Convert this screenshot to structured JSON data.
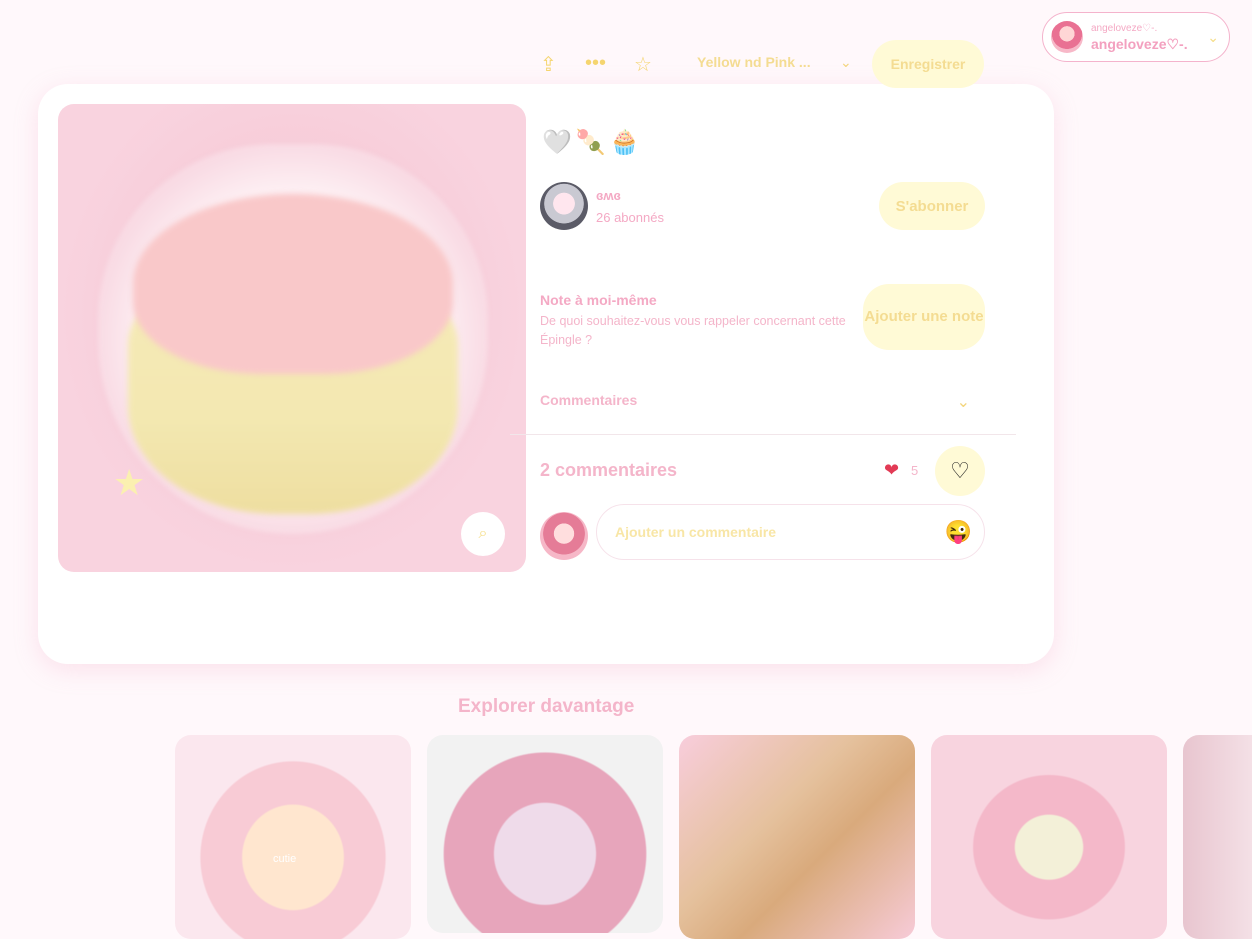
{
  "account": {
    "username_small": "angeloveze♡-.",
    "username": "angeloveze♡-."
  },
  "pin": {
    "toolbar": {
      "board_name": "Yellow nd Pink ...",
      "save_label": "Enregistrer"
    },
    "emojis": "🤍🍡🧁",
    "author": {
      "name": "ɞʍɞ",
      "followers": "26 abonnés",
      "follow_label": "S'abonner"
    },
    "note": {
      "title": "Note à moi-même",
      "description": "De quoi souhaitez-vous vous rappeler concernant cette Épingle ?",
      "button_label": "Ajouter une note"
    },
    "comments": {
      "section_label": "Commentaires",
      "count_label": "2 commentaires",
      "reaction_count": "5",
      "input_placeholder": "Ajouter un commentaire"
    }
  },
  "explore": {
    "title": "Explorer davantage",
    "items": [
      {
        "caption": "cutie"
      },
      {
        "caption": ""
      },
      {
        "caption": ""
      },
      {
        "caption": ""
      },
      {
        "caption": ""
      }
    ]
  },
  "colors": {
    "accent_pink": "#f4a9c4",
    "accent_yellow": "#fffad6",
    "background": "#fff8fb"
  }
}
